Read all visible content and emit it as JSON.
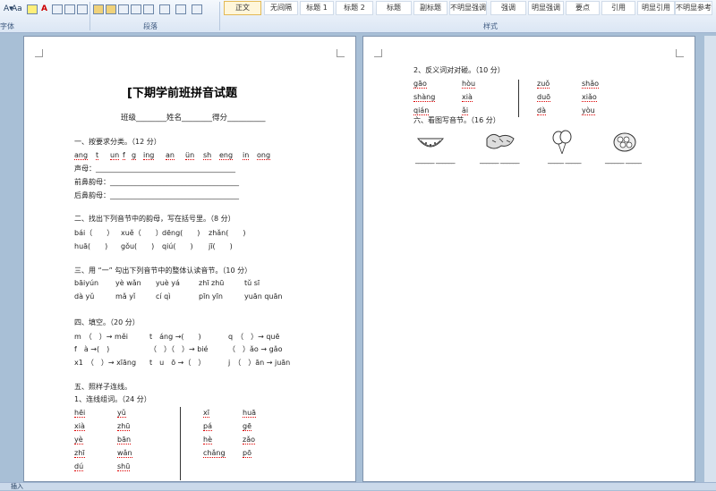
{
  "ribbon": {
    "font_size_label": "Aa",
    "group_font": "字体",
    "group_paragraph": "段落",
    "group_styles": "样式",
    "styles": [
      "正文",
      "无间隔",
      "标题 1",
      "标题 2",
      "标题",
      "副标题",
      "不明显强调",
      "强调",
      "明显强调",
      "要点",
      "引用",
      "明显引用",
      "不明显参考"
    ]
  },
  "page1": {
    "title": "[下期学前班拼音试题",
    "header_line": "班级________姓名________得分__________",
    "s1": "一、按要求分类。（12 分）",
    "s1_items": [
      "ang",
      "t",
      "un",
      "f",
      "g",
      "ing",
      "an",
      "ün",
      "sh",
      "eng",
      "in",
      "ong"
    ],
    "s1_l1": "声母：_______________________________________",
    "s1_l2": "前鼻韵母：____________________________________",
    "s1_l3": "后鼻韵母：____________________________________",
    "s2": "二、找出下列音节中的韵母，写在括号里。（8 分）",
    "s2_r1": [
      "bái（　　）",
      "xuě（　　）",
      "dēng(　　)",
      "zhǎn(　　)"
    ],
    "s2_r2": [
      "huā(　　)",
      "gǒu(　　)",
      "qiú(　　)",
      "jī(　　)"
    ],
    "s3": "三、用 “一” 勾出下列音节中的整体认读音节。（10 分）",
    "s3_r1": [
      "bāiyún",
      "yè wǎn",
      "yuè yá",
      "zhī zhū",
      "tǔ sī"
    ],
    "s3_r2": [
      "dà yǔ",
      "mǎ yǐ",
      "cí qì",
      "pīn yīn",
      "yuān quān"
    ],
    "s4": "四、填空。（20 分）",
    "s4_r1": [
      "m　（　）→ měi",
      "t　áng →(　　)",
      "q　（　）→ quē"
    ],
    "s4_r2": [
      "f　à →(　)",
      "（　）（　）→ bié",
      "（　）ǎo → gǎo"
    ],
    "s4_r3": [
      "x1　（　）→ xīāng",
      "t　u　ō →（　）",
      "j　（　）ān → juān"
    ],
    "s5": "五、照样子连线。",
    "s5_sub": "1、连线组词。（24 分）",
    "s5_left": [
      "hēi",
      "xià",
      "yè",
      "zhī",
      "dú"
    ],
    "s5_mid": [
      "yǔ",
      "zhū",
      "bān",
      "wǎn",
      "shū"
    ],
    "s5_right_a": [
      "xī",
      "pá",
      "hè",
      "chǎng"
    ],
    "s5_right_b": [
      "huā",
      "gē",
      "zǎo",
      "pō"
    ]
  },
  "page2": {
    "s6": "2、反义词对对碰。（10 分）",
    "rows_left": [
      [
        "gāo",
        "hòu"
      ],
      [
        "shàng",
        "xià"
      ],
      [
        "qián",
        "ǎi"
      ]
    ],
    "rows_right": [
      [
        "zuǒ",
        "shǎo"
      ],
      [
        "duō",
        "xiǎo"
      ],
      [
        "dà",
        "yòu"
      ]
    ],
    "s7": "六、看图写音节。（16 分）"
  },
  "statusbar": {
    "mode": "插入"
  }
}
